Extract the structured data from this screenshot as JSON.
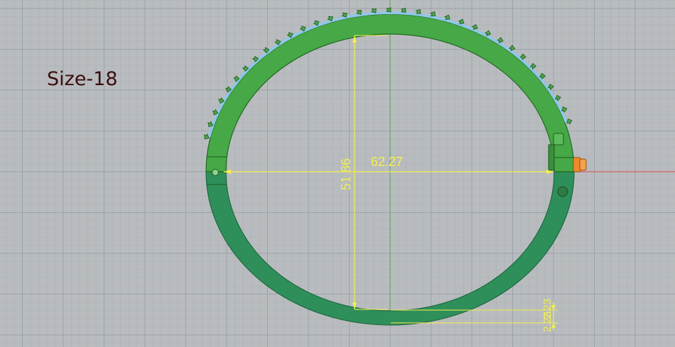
{
  "viewport": {
    "background": "#b9bcbf",
    "grid_minor_color": "#aab0b6",
    "grid_major_color": "#9aa2aa",
    "axis_x_color": "#d46060",
    "axis_y_color": "#4fa84f"
  },
  "model": {
    "size_label": "Size-18",
    "band_color": "#3e9e3e",
    "band_color_lower": "#2e8c5a",
    "stones_color": "#8fc7e6",
    "clasp_color": "#f08a2a"
  },
  "dimensions": {
    "color": "#f4f04a",
    "width_value": "62.27",
    "height_value": "51.86",
    "thickness_top_value": "2.23",
    "thickness_bottom_value": "2.23"
  }
}
